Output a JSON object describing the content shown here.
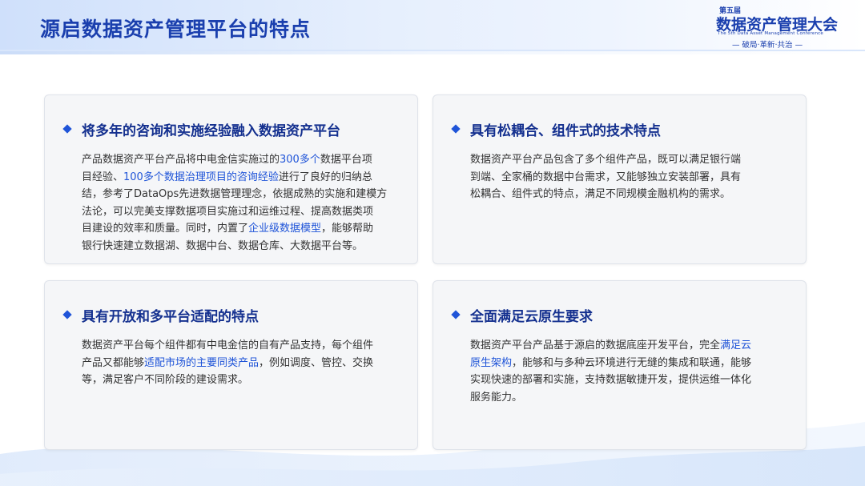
{
  "header": {
    "title": "源启数据资产管理平台的特点"
  },
  "logo": {
    "edition": "第五届",
    "name": "数据资产管理大会",
    "english": "The 5th Data Asset Management Conference",
    "slogan": "— 破局·革新·共治 —"
  },
  "cards": [
    {
      "title": "将多年的咨询和实施经验融入数据资产平台",
      "lines": [
        [
          {
            "t": "产品数据资产平台产品将中电金信实施过的"
          },
          {
            "t": "300多个",
            "hl": true
          },
          {
            "t": "数据平台项"
          }
        ],
        [
          {
            "t": "目经验、"
          },
          {
            "t": "100多个数据治理项目的咨询经验",
            "hl": true
          },
          {
            "t": "进行了良好的归纳总"
          }
        ],
        [
          {
            "t": "结，参考了DataOps先进数据管理理念，依据成熟的实施和建模方"
          }
        ],
        [
          {
            "t": "法论，可以完美支撑数据项目实施过和运维过程、提高数据类项"
          }
        ],
        [
          {
            "t": "目建设的效率和质量。同时，内置了"
          },
          {
            "t": "企业级数据模型",
            "hl": true
          },
          {
            "t": "，能够帮助"
          }
        ],
        [
          {
            "t": "银行快速建立数据湖、数据中台、数据仓库、大数据平台等。"
          }
        ]
      ]
    },
    {
      "title": "具有松耦合、组件式的技术特点",
      "lines": [
        [
          {
            "t": "数据资产平台产品包含了多个组件产品，既可以满足银行端"
          }
        ],
        [
          {
            "t": "到端、全家桶的数据中台需求，又能够独立安装部署，具有"
          }
        ],
        [
          {
            "t": "松耦合、组件式的特点，满足不同规模金融机构的需求。"
          }
        ]
      ]
    },
    {
      "title": "具有开放和多平台适配的特点",
      "lines": [
        [
          {
            "t": "数据资产平台每个组件都有中电金信的自有产品支持，每个组件"
          }
        ],
        [
          {
            "t": "产品又都能够"
          },
          {
            "t": "适配市场的主要同类产品",
            "hl": true
          },
          {
            "t": "，例如调度、管控、交换"
          }
        ],
        [
          {
            "t": "等，满足客户不同阶段的建设需求。"
          }
        ]
      ]
    },
    {
      "title": "全面满足云原生要求",
      "lines": [
        [
          {
            "t": "数据资产平台产品基于源启的数据底座开发平台，完全"
          },
          {
            "t": "满足云",
            "hl": true
          }
        ],
        [
          {
            "t": "原生架构",
            "hl": true
          },
          {
            "t": "，能够和与多种云环境进行无缝的集成和联通，能够"
          }
        ],
        [
          {
            "t": "实现快速的部署和实施，支持数据敏捷开发，提供运维一体化"
          }
        ],
        [
          {
            "t": "服务能力。"
          }
        ]
      ]
    }
  ],
  "colors": {
    "title_blue": "#1a3fae",
    "highlight_blue": "#1f54d8"
  }
}
